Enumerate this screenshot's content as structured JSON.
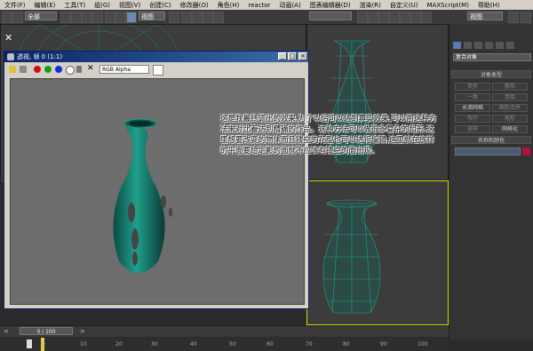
{
  "menubar": {
    "items": [
      "文件(F)",
      "编辑(E)",
      "工具(T)",
      "组(G)",
      "视图(V)",
      "创建(C)",
      "修改器(O)",
      "角色(H)",
      "reactor",
      "动画(A)",
      "图表编辑器(D)",
      "渲染(R)",
      "自定义(U)",
      "MAXScript(M)",
      "帮助(H)"
    ]
  },
  "toolbar": {
    "selection_filter": "全部",
    "view_dropdown": "视图"
  },
  "render_window": {
    "title": "透视, 帧 0 (1:1)",
    "channel_dropdown": "RGB Alpha"
  },
  "command_panel": {
    "object_type_title": "对象类型",
    "compound_dropdown": "复合对象",
    "buttons": [
      "变形",
      "散布",
      "一致",
      "连接",
      "水滴网格",
      "图形合并",
      "布尔",
      "地形",
      "放样",
      "网格化"
    ],
    "name_color_title": "名称和颜色",
    "swatch_color": "#b0123c"
  },
  "caption": {
    "text": "这是我最终调出的效果,为了以后可以达到真实效果,可以用这种方法来对比着达到精确的作品。这种方法可以做很多复杂的组形,这里想要改变的物体而且镂空的花型也可以进行编辑,这里就在放样的平面要给定影的面就不应该有镂空的面出现。"
  },
  "timeline": {
    "frame_label": "0 / 100"
  },
  "ruler": {
    "ticks": [
      "0",
      "10",
      "20",
      "30",
      "40",
      "50",
      "60",
      "70",
      "80",
      "90",
      "100"
    ]
  }
}
